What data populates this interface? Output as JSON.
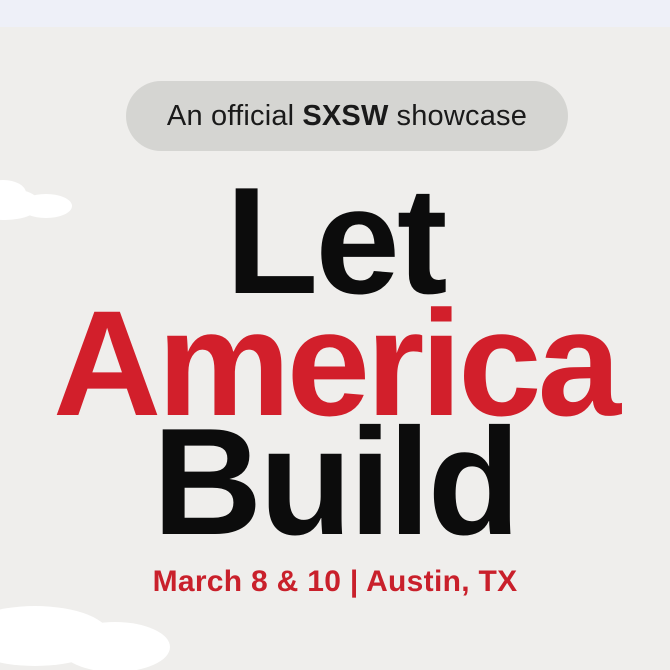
{
  "badge": {
    "prefix": "An official",
    "highlight": "SXSW",
    "suffix": "showcase"
  },
  "headline": {
    "line1": "Let",
    "line2": "America",
    "line3": "Build"
  },
  "event": {
    "date_location": "March 8 & 10 | Austin, TX"
  },
  "colors": {
    "accent_red": "#d21f2b",
    "text_black": "#0c0c0c",
    "background": "#efeeec",
    "pill": "#d5d5d2"
  }
}
